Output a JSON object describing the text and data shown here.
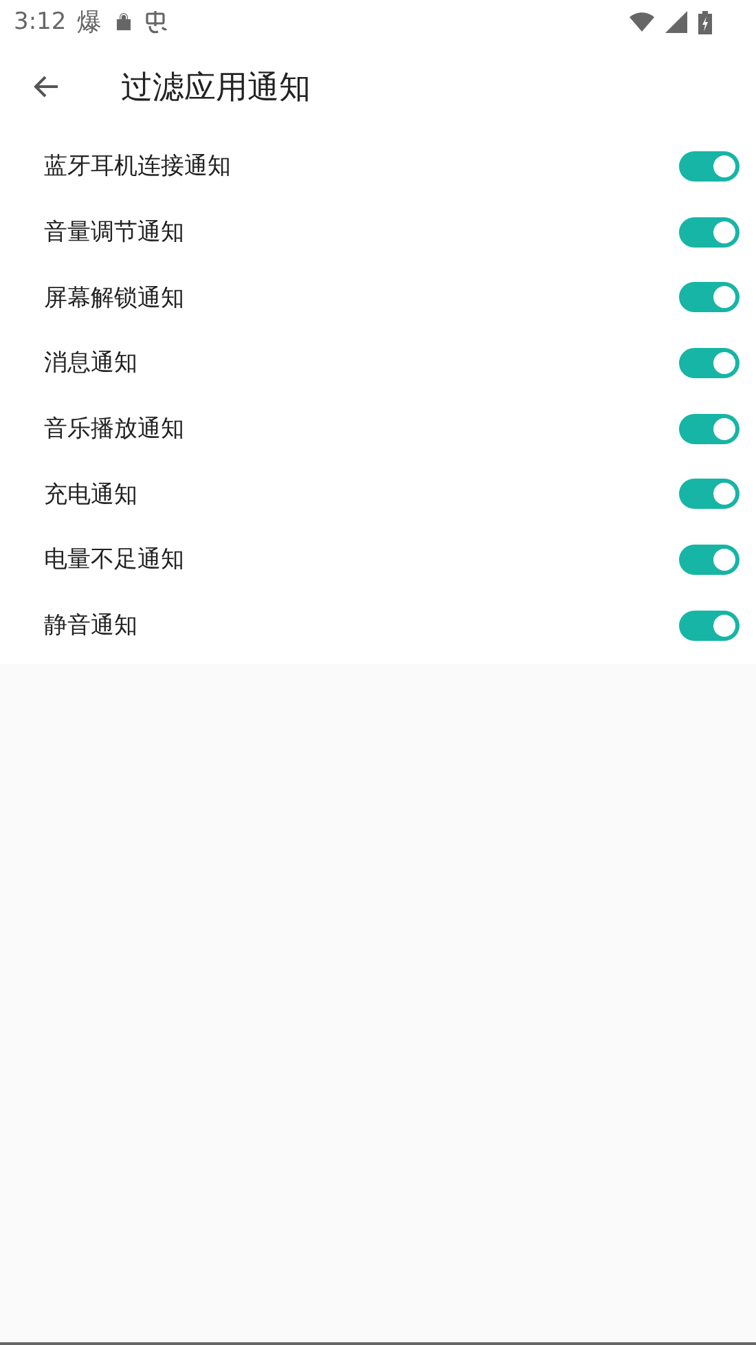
{
  "status_bar": {
    "time": "3:12",
    "app_glyph": "爆"
  },
  "header": {
    "title": "过滤应用通知"
  },
  "settings": [
    {
      "label": "蓝牙耳机连接通知",
      "on": true
    },
    {
      "label": "音量调节通知",
      "on": true
    },
    {
      "label": "屏幕解锁通知",
      "on": true
    },
    {
      "label": "消息通知",
      "on": true
    },
    {
      "label": "音乐播放通知",
      "on": true
    },
    {
      "label": "充电通知",
      "on": true
    },
    {
      "label": "电量不足通知",
      "on": true
    },
    {
      "label": "静音通知",
      "on": true
    }
  ]
}
